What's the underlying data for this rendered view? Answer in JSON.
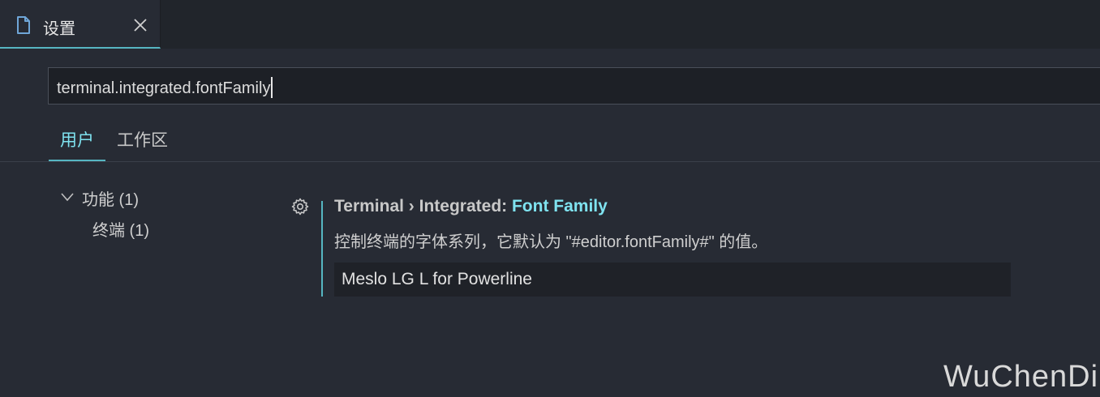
{
  "tab": {
    "label": "设置",
    "icon": "file-icon",
    "close_icon": "close-icon"
  },
  "search": {
    "value": "terminal.integrated.fontFamily"
  },
  "scope_tabs": [
    {
      "label": "用户",
      "active": true
    },
    {
      "label": "工作区",
      "active": false
    }
  ],
  "toc": {
    "features": "功能 (1)",
    "terminal": "终端 (1)"
  },
  "setting": {
    "category": "Terminal › Integrated: ",
    "name": "Font Family",
    "description": "控制终端的字体系列，它默认为 \"#editor.fontFamily#\" 的值。",
    "value": "Meslo LG L for Powerline"
  },
  "watermark": "WuChenDi",
  "colors": {
    "accent": "#56b6c2",
    "background": "#272b34",
    "highlight": "#7fe3f0"
  }
}
